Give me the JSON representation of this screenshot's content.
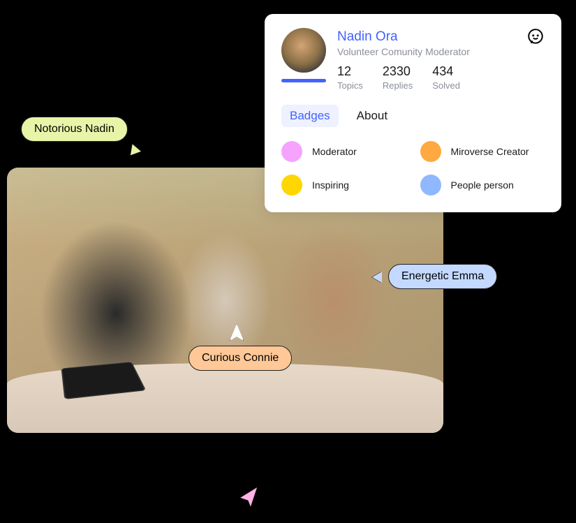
{
  "cursors": {
    "nadin": "Notorious Nadin",
    "connie": "Curious Connie",
    "emma": "Energetic Emma"
  },
  "profile": {
    "name": "Nadin Ora",
    "role": "Volunteer Comunity Moderator",
    "stats": {
      "topics": {
        "value": "12",
        "label": "Topics"
      },
      "replies": {
        "value": "2330",
        "label": "Replies"
      },
      "solved": {
        "value": "434",
        "label": "Solved"
      }
    },
    "tabs": {
      "badges": "Badges",
      "about": "About"
    },
    "badges": {
      "moderator": {
        "label": "Moderator",
        "color": "#f5a3ff"
      },
      "miroverse": {
        "label": "Miroverse Creator",
        "color": "#ffa940"
      },
      "inspiring": {
        "label": "Inspiring",
        "color": "#ffd600"
      },
      "people": {
        "label": "People person",
        "color": "#8fb8ff"
      }
    }
  }
}
